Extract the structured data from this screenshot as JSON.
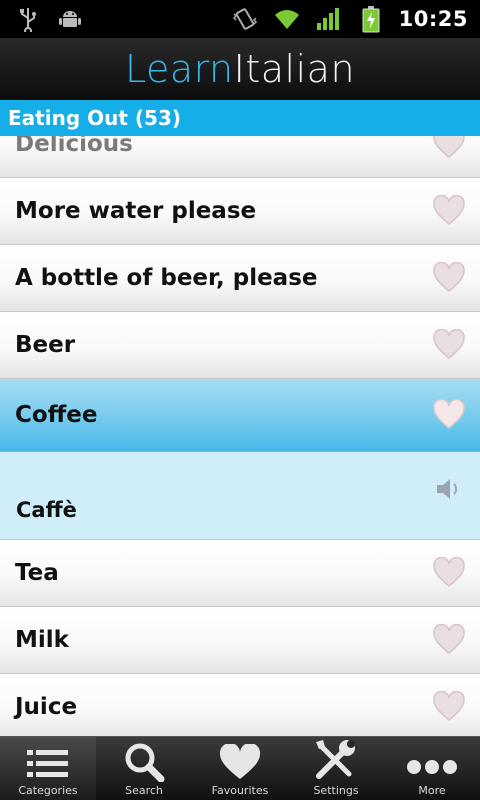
{
  "status_bar": {
    "time": "10:25",
    "icons": [
      "usb-icon",
      "android-debug-icon",
      "vibrate-icon",
      "wifi-icon",
      "signal-icon",
      "battery-charging-icon"
    ]
  },
  "app": {
    "title_part1": "Learn",
    "title_part2": "Italian",
    "brand_color": "#39b6e9"
  },
  "category": {
    "name": "Eating Out",
    "count": "(53)"
  },
  "list": {
    "items": [
      {
        "label": "Delicious"
      },
      {
        "label": "More water please"
      },
      {
        "label": "A bottle of beer, please"
      },
      {
        "label": "Beer"
      },
      {
        "label": "Coffee"
      },
      {
        "label": "Tea"
      },
      {
        "label": "Milk"
      },
      {
        "label": "Juice"
      }
    ],
    "expanded_translation": "Caffè"
  },
  "tabs": [
    {
      "label": "Categories",
      "icon": "list-icon"
    },
    {
      "label": "Search",
      "icon": "search-icon"
    },
    {
      "label": "Favourites",
      "icon": "heart-icon"
    },
    {
      "label": "Settings",
      "icon": "tools-icon"
    },
    {
      "label": "More",
      "icon": "more-dots-icon"
    }
  ],
  "colors": {
    "accent": "#16aee8",
    "selected_row": "#7fcdee",
    "translation_bg": "#d0eef9"
  }
}
